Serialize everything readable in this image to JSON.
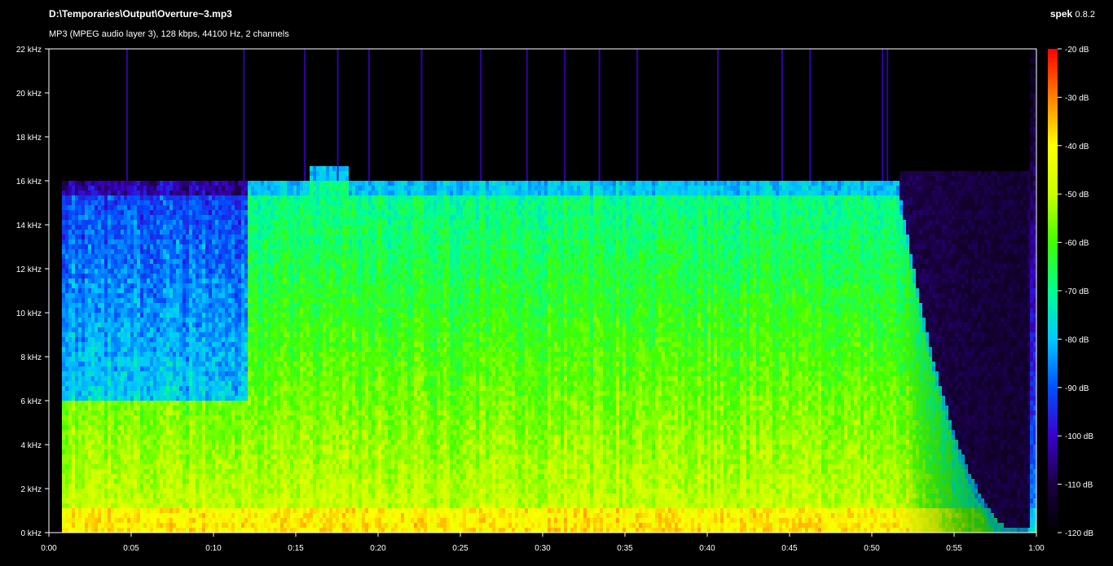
{
  "header": {
    "file_path": "D:\\Temporaries\\Output\\Overture~3.mp3",
    "file_info": "MP3 (MPEG audio layer 3), 128 kbps, 44100 Hz, 2 channels",
    "app_name": "spek",
    "app_version": "0.8.2"
  },
  "colors": {
    "background": "#000000",
    "axis": "#ffffff"
  },
  "chart_data": {
    "type": "heatmap",
    "title": "D:\\Temporaries\\Output\\Overture~3.mp3",
    "x_tick_labels": [
      "0:00",
      "0:05",
      "0:10",
      "0:15",
      "0:20",
      "0:25",
      "0:30",
      "0:35",
      "0:40",
      "0:45",
      "0:50",
      "0:55",
      "1:00"
    ],
    "y_tick_labels": [
      "0 kHz",
      "2 kHz",
      "4 kHz",
      "6 kHz",
      "8 kHz",
      "10 kHz",
      "12 kHz",
      "14 kHz",
      "16 kHz",
      "18 kHz",
      "20 kHz",
      "22 kHz"
    ],
    "xlim_seconds": [
      0,
      60
    ],
    "ylim_khz": [
      0,
      22
    ],
    "colorbar_labels": [
      "-20 dB",
      "-30 dB",
      "-40 dB",
      "-50 dB",
      "-60 dB",
      "-70 dB",
      "-80 dB",
      "-90 dB",
      "-100 dB",
      "-110 dB",
      "-120 dB"
    ],
    "colorbar_range_db": [
      -120,
      -20
    ],
    "colorbar_colors": [
      "#000000",
      "#1a0040",
      "#3a00c8",
      "#0050ff",
      "#00c8ff",
      "#00ff90",
      "#40ff00",
      "#c8ff00",
      "#ffff00",
      "#ff8000",
      "#ff0000"
    ],
    "audio_start_seconds": 0.7,
    "lowpass_khz": 16,
    "lowpass_raised_khz": 16.7,
    "lowpass_raised_range_seconds": [
      15.8,
      18.2
    ],
    "audio_fade_seconds": [
      51.5,
      59.5
    ]
  }
}
